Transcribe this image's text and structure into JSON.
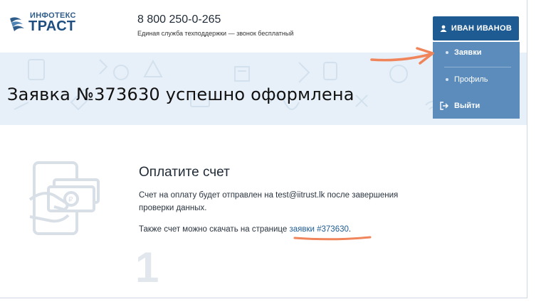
{
  "header": {
    "logo_top": "ИНФОТЕКС",
    "logo_main": "ТРАСТ",
    "phone": "8 800 250-0-265",
    "support_text": "Единая служба техподдержки — звонок бесплатный"
  },
  "user_menu": {
    "user_name": "ИВАН ИВАНОВ",
    "items": [
      {
        "label": "Заявки"
      },
      {
        "label": "Профиль"
      },
      {
        "label": "Выйти"
      }
    ]
  },
  "page": {
    "title": "Заявка №373630 успешно оформлена"
  },
  "payment": {
    "step_number": "1",
    "title": "Оплатите счет",
    "description": "Счет на оплату будет отправлен на test@iitrust.lk после завершения проверки данных.",
    "download_prefix": "Также счет можно скачать на странице ",
    "order_link": "заявки #373630",
    "download_suffix": "."
  },
  "colors": {
    "primary": "#1e5b92",
    "dropdown_bg": "#5b8cbc",
    "banner_bg": "#e7f0f8",
    "annotation": "#f0845a"
  }
}
